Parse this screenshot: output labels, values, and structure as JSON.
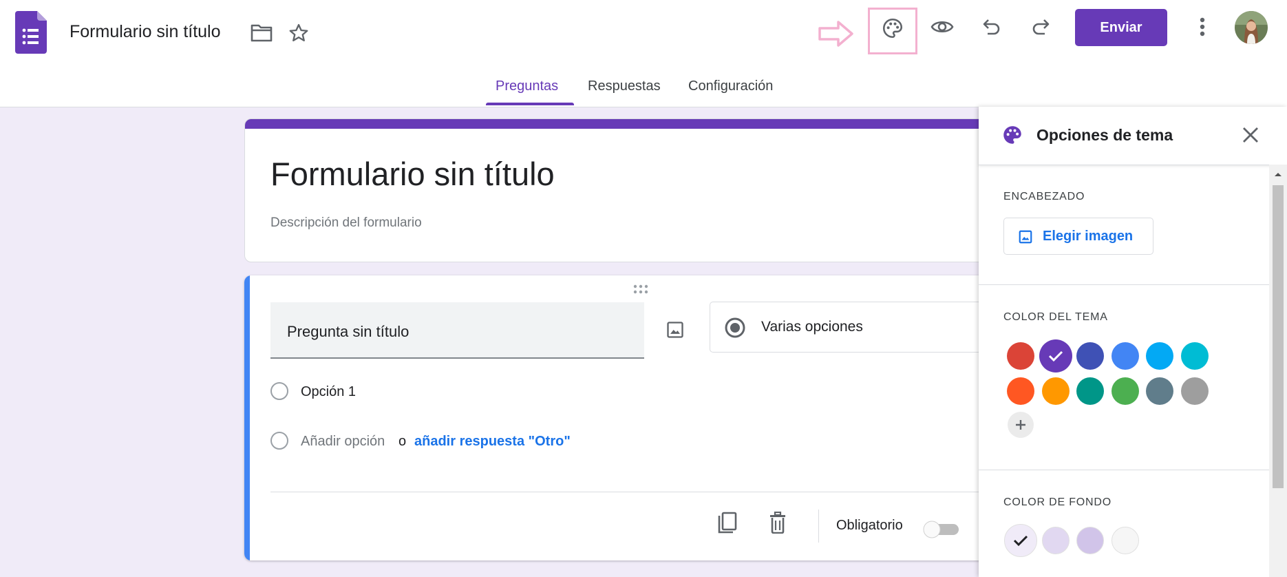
{
  "header": {
    "app_title": "Formulario sin título",
    "send_label": "Enviar",
    "icons": [
      "forms-logo-icon",
      "folder-icon",
      "star-icon",
      "arrow-right-icon",
      "palette-icon",
      "eye-icon",
      "undo-icon",
      "redo-icon",
      "more-vert-icon"
    ]
  },
  "tabs": [
    {
      "label": "Preguntas",
      "active": true
    },
    {
      "label": "Respuestas",
      "active": false
    },
    {
      "label": "Configuración",
      "active": false
    }
  ],
  "form": {
    "title": "Formulario sin título",
    "description": "Descripción del formulario"
  },
  "question": {
    "title": "Pregunta sin título",
    "type": "Varias opciones",
    "option1": "Opción 1",
    "add_option": "Añadir opción",
    "or": "o",
    "add_other": "añadir respuesta \"Otro\"",
    "required_label": "Obligatorio",
    "required": false
  },
  "theme_panel": {
    "title": "Opciones de tema",
    "header_section": "ENCABEZADO",
    "choose_image": "Elegir imagen",
    "theme_color_section": "COLOR DEL TEMA",
    "theme_colors": [
      "#db4437",
      "#673ab7",
      "#3f51b5",
      "#4285f4",
      "#03a9f4",
      "#00bcd4",
      "#ff5722",
      "#ff9800",
      "#009688",
      "#4caf50",
      "#607d8b",
      "#9e9e9e"
    ],
    "selected_theme_color": "#673ab7",
    "background_section": "COLOR DE FONDO",
    "background_colors": [
      "#f0ebf8",
      "#e1d8f1",
      "#d1c4e9",
      "#f6f6f6"
    ],
    "selected_background_color": "#f0ebf8"
  },
  "colors": {
    "accent": "#673ab7",
    "question_accent": "#4285f4",
    "link": "#1a73e8",
    "highlight": "#f3b0cf"
  }
}
